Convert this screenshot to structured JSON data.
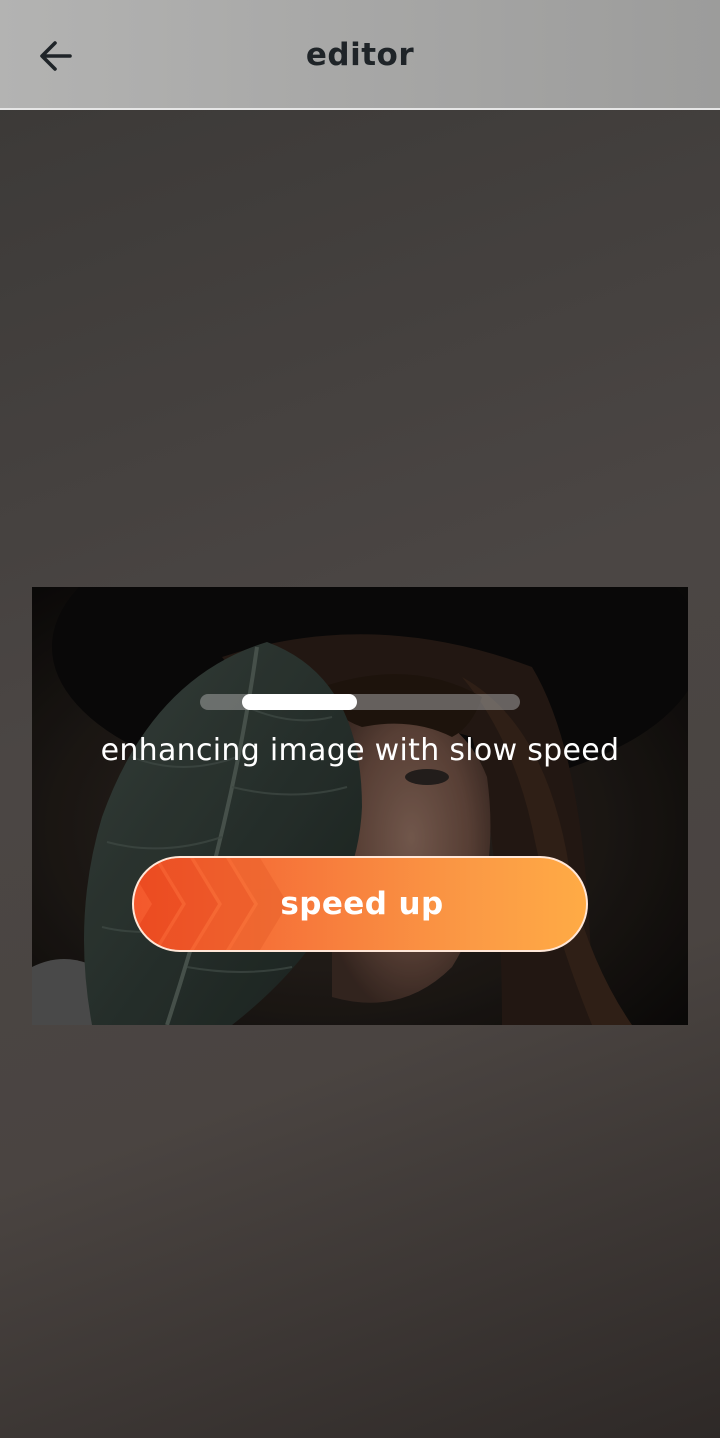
{
  "appbar": {
    "title": "editor",
    "back_icon": "arrow-left-icon"
  },
  "preview": {
    "status_text": "enhancing image with slow speed",
    "progress": {
      "fill_start_fraction": 0.13,
      "fill_end_fraction": 0.49
    },
    "speed_button": {
      "label": "speed up",
      "icon": "chevrons-right-icon"
    }
  },
  "colors": {
    "accent_start": "#f4582c",
    "accent_end": "#ffab45",
    "appbar_bg": "#a9a9a8",
    "title_color": "#1f2428"
  }
}
